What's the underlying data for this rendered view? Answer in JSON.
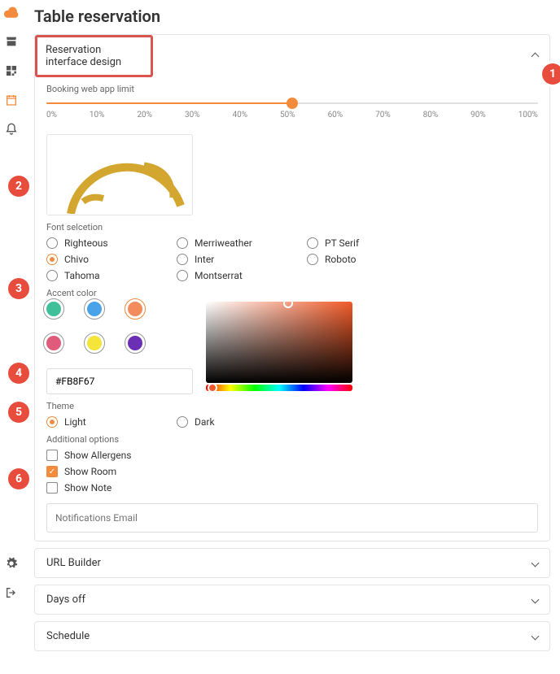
{
  "page": {
    "title": "Table reservation"
  },
  "panels": {
    "design": {
      "title": "Reservation interface design"
    },
    "urlBuilder": {
      "title": "URL Builder"
    },
    "daysOff": {
      "title": "Days off"
    },
    "schedule": {
      "title": "Schedule"
    }
  },
  "booking": {
    "label": "Booking web app limit",
    "ticks": [
      "0%",
      "10%",
      "20%",
      "30%",
      "40%",
      "50%",
      "60%",
      "70%",
      "80%",
      "90%",
      "100%"
    ],
    "value_percent": 50
  },
  "font": {
    "label": "Font selcetion",
    "options": [
      "Righteous",
      "Merriweather",
      "PT Serif",
      "Chivo",
      "Inter",
      "Roboto",
      "Tahoma",
      "Montserrat"
    ],
    "selected": "Chivo"
  },
  "accent": {
    "label": "Accent color",
    "hex": "#FB8F67",
    "swatches": [
      "#3fbf9a",
      "#4aa3e8",
      "#f38b5c",
      "",
      "#e05a7b",
      "#f5e43a",
      "#6b2fb5",
      ""
    ],
    "selected_index": 2
  },
  "theme": {
    "label": "Theme",
    "options": [
      "Light",
      "Dark"
    ],
    "selected": "Light"
  },
  "additional": {
    "label": "Additional options",
    "options": [
      {
        "label": "Show Allergens",
        "checked": false
      },
      {
        "label": "Show Room",
        "checked": true
      },
      {
        "label": "Show Note",
        "checked": false
      }
    ]
  },
  "notify": {
    "placeholder": "Notifications Email"
  },
  "callouts": [
    "1",
    "2",
    "3",
    "4",
    "5",
    "6"
  ]
}
